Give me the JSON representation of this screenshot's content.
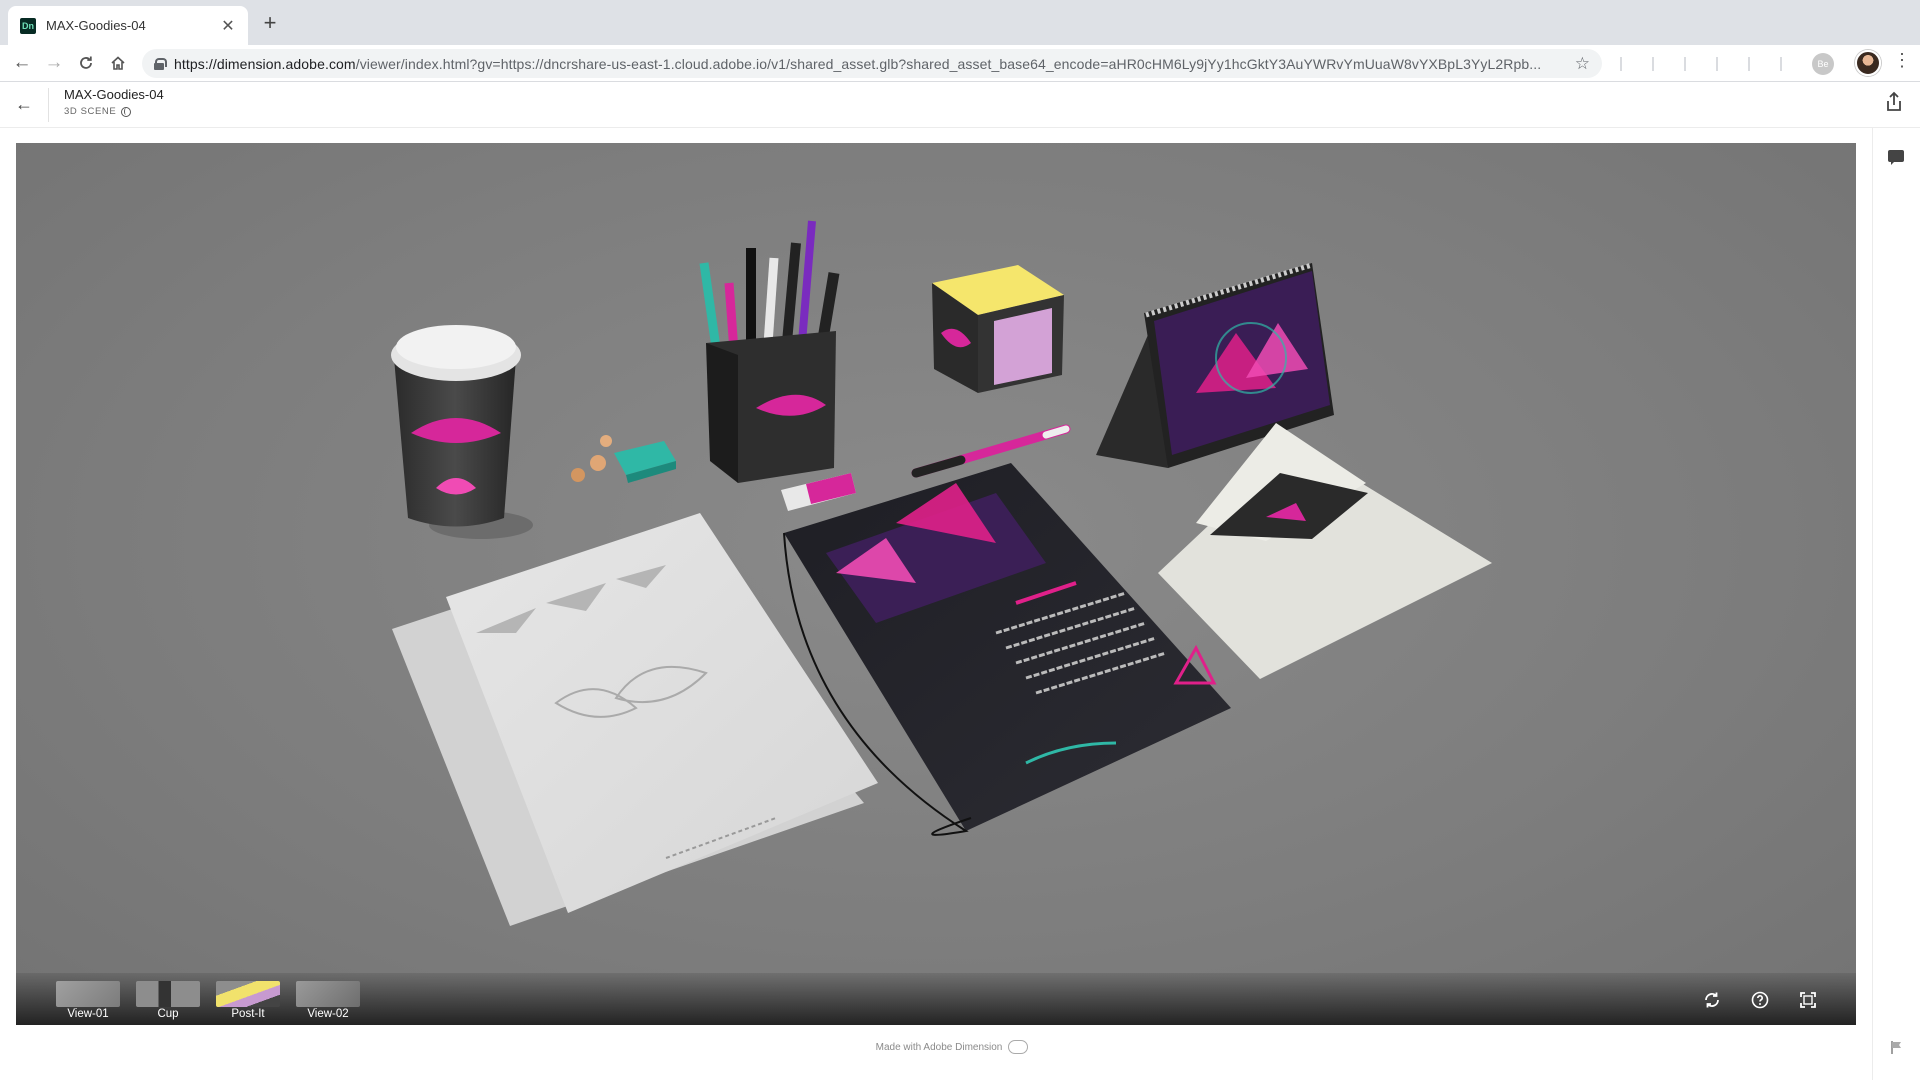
{
  "browser": {
    "tab_title": "MAX-Goodies-04",
    "favicon_text": "Dn",
    "url_host": "https://dimension.adobe.com",
    "url_rest": "/viewer/index.html?gv=https://dncrshare-us-east-1.cloud.adobe.io/v1/shared_asset.glb?shared_asset_base64_encode=aHR0cHM6Ly9jYy1hcGktY3AuYWRvYmUuaW8vYXBpL3YyL2Rpb...",
    "ext_badge": "Be"
  },
  "header": {
    "title": "MAX-Goodies-04",
    "subtitle": "3D SCENE"
  },
  "views": [
    {
      "label": "View-01"
    },
    {
      "label": "Cup"
    },
    {
      "label": "Post-It"
    },
    {
      "label": "View-02"
    }
  ],
  "footer": {
    "credit": "Made with Adobe Dimension"
  },
  "icons": {
    "back": "arrow-left-icon",
    "forward": "arrow-right-icon",
    "reload": "reload-icon",
    "home": "home-icon",
    "star": "star-icon",
    "share": "share-icon",
    "comment": "comment-icon",
    "flag": "flag-icon",
    "reset_view": "refresh-icon",
    "help": "help-icon",
    "fullscreen": "fullscreen-icon"
  },
  "colors": {
    "viewer_bg": "#808080",
    "accent_magenta": "#e0208a",
    "accent_teal": "#2fb8a6"
  }
}
